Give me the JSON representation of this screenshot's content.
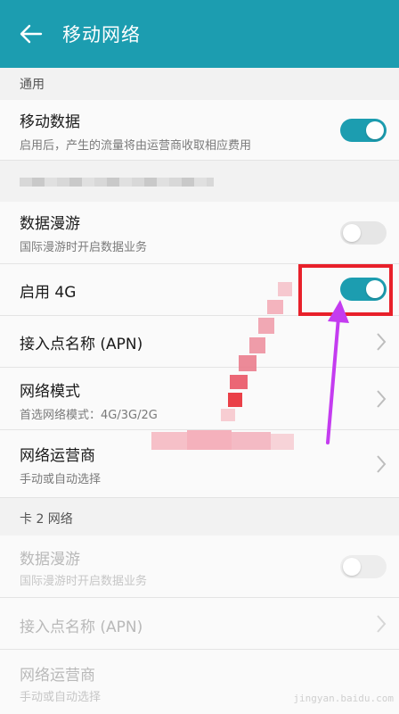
{
  "appbar": {
    "title": "移动网络",
    "back_icon": "arrow-left-icon"
  },
  "colors": {
    "accent": "#1c9db0",
    "annotation_red": "#e8202a",
    "annotation_arrow": "#c43cf0"
  },
  "sections": {
    "general": "通用",
    "sim2": "卡 2 网络"
  },
  "general": {
    "mobile_data": {
      "title": "移动数据",
      "subtitle": "启用后，产生的流量将由运营商收取相应费用",
      "on": true
    }
  },
  "sim1": {
    "roaming": {
      "title": "数据漫游",
      "subtitle": "国际漫游时开启数据业务",
      "on": false
    },
    "enable4g": {
      "title": "启用 4G",
      "on": true
    },
    "apn": {
      "title": "接入点名称 (APN)"
    },
    "network_mode": {
      "title": "网络模式",
      "subtitle": "首选网络模式：4G/3G/2G"
    },
    "operator": {
      "title": "网络运营商",
      "subtitle": "手动或自动选择"
    }
  },
  "sim2": {
    "roaming": {
      "title": "数据漫游",
      "subtitle": "国际漫游时开启数据业务",
      "on": false
    },
    "apn": {
      "title": "接入点名称 (APN)"
    },
    "operator": {
      "title": "网络运营商",
      "subtitle": "手动或自动选择"
    }
  },
  "watermark": "jingyan.baidu.com"
}
